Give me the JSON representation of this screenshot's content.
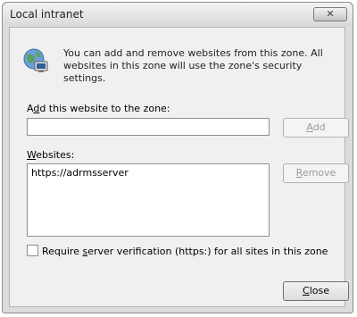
{
  "window": {
    "title": "Local intranet",
    "close_glyph": "✕"
  },
  "info": {
    "icon": "globe-computer-icon",
    "text": "You can add and remove websites from this zone. All websites in this zone will use the zone's security settings."
  },
  "add_section": {
    "label_a": "A",
    "label_mn": "d",
    "label_b": "d this website to the zone:",
    "input_value": "",
    "add_mn": "A",
    "add_rest": "dd"
  },
  "websites": {
    "label_mn": "W",
    "label_rest": "ebsites:",
    "items": [
      "https://adrmsserver"
    ],
    "remove_mn": "R",
    "remove_rest": "emove"
  },
  "require_https": {
    "checked": false,
    "label_a": "Require ",
    "label_mn": "s",
    "label_b": "erver verification (https:) for all sites in this zone"
  },
  "footer": {
    "close_mn": "C",
    "close_rest": "lose"
  }
}
